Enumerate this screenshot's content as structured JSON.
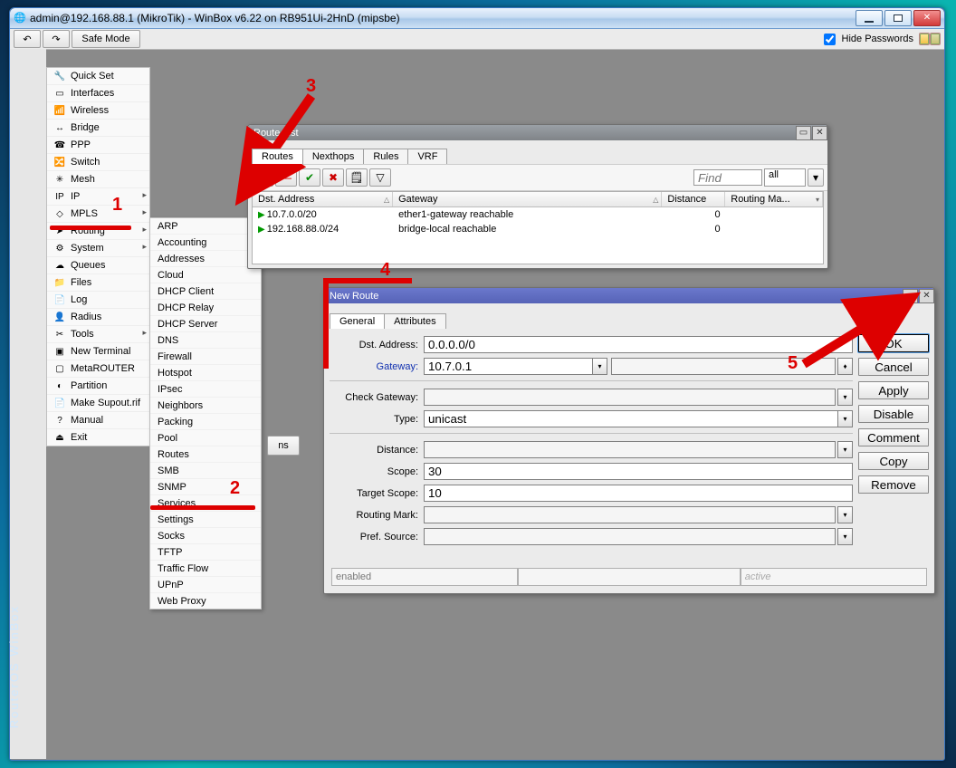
{
  "window_title": "admin@192.168.88.1 (MikroTik) - WinBox v6.22 on RB951Ui-2HnD (mipsbe)",
  "toolbar": {
    "undo": "↶",
    "redo": "↷",
    "safe_mode": "Safe Mode",
    "hide_passwords": "Hide Passwords"
  },
  "brand_text": "RouterOS WinBox",
  "menu1": [
    {
      "label": "Quick Set",
      "icon": "🔧"
    },
    {
      "label": "Interfaces",
      "icon": "▭"
    },
    {
      "label": "Wireless",
      "icon": "📶"
    },
    {
      "label": "Bridge",
      "icon": "↔"
    },
    {
      "label": "PPP",
      "icon": "☎"
    },
    {
      "label": "Switch",
      "icon": "🔀"
    },
    {
      "label": "Mesh",
      "icon": "✳"
    },
    {
      "label": "IP",
      "icon": "IP",
      "sub": true,
      "hl": 1
    },
    {
      "label": "MPLS",
      "icon": "◇",
      "sub": true
    },
    {
      "label": "Routing",
      "icon": "➤",
      "sub": true
    },
    {
      "label": "System",
      "icon": "⚙",
      "sub": true
    },
    {
      "label": "Queues",
      "icon": "☁"
    },
    {
      "label": "Files",
      "icon": "📁"
    },
    {
      "label": "Log",
      "icon": "📄"
    },
    {
      "label": "Radius",
      "icon": "👤"
    },
    {
      "label": "Tools",
      "icon": "✂",
      "sub": true
    },
    {
      "label": "New Terminal",
      "icon": "▣"
    },
    {
      "label": "MetaROUTER",
      "icon": "▢"
    },
    {
      "label": "Partition",
      "icon": "◐"
    },
    {
      "label": "Make Supout.rif",
      "icon": "📄"
    },
    {
      "label": "Manual",
      "icon": "?"
    },
    {
      "label": "Exit",
      "icon": "⏏"
    }
  ],
  "menu2": [
    "ARP",
    "Accounting",
    "Addresses",
    "Cloud",
    "DHCP Client",
    "DHCP Relay",
    "DHCP Server",
    "DNS",
    "Firewall",
    "Hotspot",
    "IPsec",
    "Neighbors",
    "Packing",
    "Pool",
    "Routes",
    "SMB",
    "SNMP",
    "Services",
    "Settings",
    "Socks",
    "TFTP",
    "Traffic Flow",
    "UPnP",
    "Web Proxy"
  ],
  "routelist": {
    "title": "Route List",
    "tabs": [
      "Routes",
      "Nexthops",
      "Rules",
      "VRF"
    ],
    "active_tab": 0,
    "find_placeholder": "Find",
    "filter_sel": "all",
    "columns": [
      "Dst. Address",
      "Gateway",
      "Distance",
      "Routing Ma..."
    ],
    "rows": [
      {
        "dst": "10.7.0.0/20",
        "gw": "ether1-gateway reachable",
        "dist": "0"
      },
      {
        "dst": "192.168.88.0/24",
        "gw": "bridge-local reachable",
        "dist": "0"
      }
    ],
    "footer_btn": "ns"
  },
  "newroute": {
    "title": "New Route",
    "tabs": [
      "General",
      "Attributes"
    ],
    "active_tab": 0,
    "fields": {
      "dst_label": "Dst. Address:",
      "dst_value": "0.0.0.0/0",
      "gw_label": "Gateway:",
      "gw_value": "10.7.0.1",
      "check_gw_label": "Check Gateway:",
      "type_label": "Type:",
      "type_value": "unicast",
      "distance_label": "Distance:",
      "scope_label": "Scope:",
      "scope_value": "30",
      "tscope_label": "Target Scope:",
      "tscope_value": "10",
      "rmark_label": "Routing Mark:",
      "psrc_label": "Pref. Source:"
    },
    "buttons": [
      "OK",
      "Cancel",
      "Apply",
      "Disable",
      "Comment",
      "Copy",
      "Remove"
    ],
    "status_left": "enabled",
    "status_right": "active"
  },
  "annotations": {
    "n1": "1",
    "n2": "2",
    "n3": "3",
    "n4": "4",
    "n5": "5"
  }
}
